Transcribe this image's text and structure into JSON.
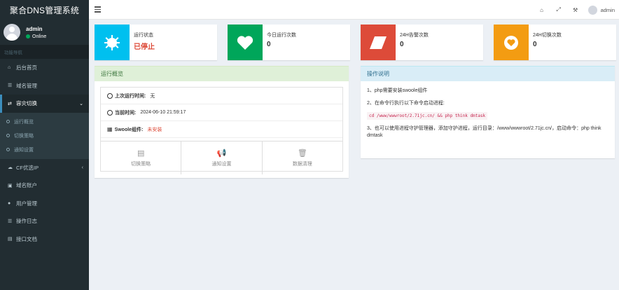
{
  "app": {
    "title": "聚合DNS管理系统"
  },
  "user": {
    "name": "admin",
    "status": "Online"
  },
  "sidebar": {
    "nav_header": "功能导航",
    "items": [
      {
        "label": "后台首页",
        "icon": "home-icon"
      },
      {
        "label": "域名管理",
        "icon": "list-icon"
      },
      {
        "label": "容灾切换",
        "icon": "switch-icon",
        "active": true
      },
      {
        "label": "CF优选IP",
        "icon": "cloud-icon"
      },
      {
        "label": "域名账户",
        "icon": "lock-icon"
      },
      {
        "label": "用户管理",
        "icon": "user-icon"
      },
      {
        "label": "操作日志",
        "icon": "list-icon"
      },
      {
        "label": "接口文档",
        "icon": "book-icon"
      }
    ],
    "sub_items": [
      {
        "label": "运行概览"
      },
      {
        "label": "切换策略"
      },
      {
        "label": "通知设置"
      }
    ]
  },
  "topbar": {
    "user": "admin"
  },
  "infoboxes": [
    {
      "label": "运行状态",
      "value": "已停止",
      "color": "#00c0ef",
      "icon": "gear-icon"
    },
    {
      "label": "今日运行次数",
      "value": "0",
      "color": "#00a65a",
      "icon": "heart-icon"
    },
    {
      "label": "24H告警次数",
      "value": "0",
      "color": "#dd4b39",
      "icon": "eraser-icon"
    },
    {
      "label": "24H切换次数",
      "value": "0",
      "color": "#f39c12",
      "icon": "heart-circle-icon"
    }
  ],
  "overview": {
    "title": "运行概览",
    "last_run_label": "上次运行时间:",
    "last_run_value": "无",
    "current_time_label": "当前时间:",
    "current_time_value": "2024-06-10 21:59:17",
    "swoole_label": "Swoole组件:",
    "swoole_value": "未安装",
    "actions": [
      {
        "label": "切换策略",
        "icon": "list-alt-icon"
      },
      {
        "label": "通知设置",
        "icon": "bullhorn-icon"
      },
      {
        "label": "数据清理",
        "icon": "trash-icon"
      }
    ]
  },
  "instructions": {
    "title": "操作说明",
    "step1": "1、php需要安装swoole组件",
    "step2": "2、在命令行执行以下命令启动进程:",
    "code": "cd /www/wwwroot/2.71jc.cn/ && php think dmtask",
    "step3": "3、也可以使用进程守护管理器，添加守护进程，运行目录：/www/wwwroot/2.71jc.cn/，启动命令：php think dmtask"
  }
}
